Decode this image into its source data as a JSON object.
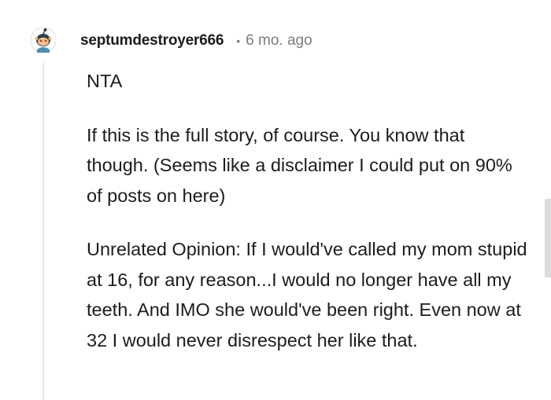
{
  "comment": {
    "author": {
      "username": "septumdestroyer666",
      "avatar_icon": "snoo-avatar-icon"
    },
    "separator": "•",
    "timestamp": "6 mo. ago",
    "paragraphs": [
      "NTA",
      "If this is the full story, of course. You know that though. (Seems like a disclaimer I could put on 90% of posts on here)",
      "Unrelated Opinion: If I would've called my mom stupid at 16, for any reason...I would no longer have all my teeth. And IMO she would've been right. Even now at 32 I would never disrespect her like that."
    ]
  },
  "colors": {
    "text": "#1c1c1c",
    "meta": "#7c7c7c",
    "thread_line": "#e8e8e8"
  }
}
